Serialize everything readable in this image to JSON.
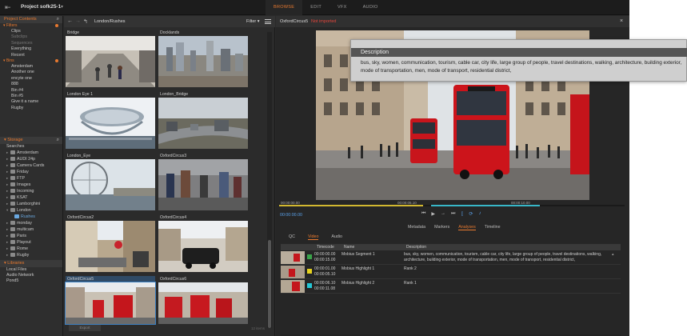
{
  "app": {
    "project_title": "Project sofk25-1",
    "modes": [
      "BROWSE",
      "EDIT",
      "VFX",
      "AUDIO"
    ],
    "active_mode": "BROWSE"
  },
  "left_panel": {
    "project_contents": "Project Contents",
    "filters_label": "Filters",
    "filters": [
      "Clips",
      "Subclips",
      "Sequences",
      "Everything",
      "Recent"
    ],
    "bins_label": "Bins",
    "bins": [
      "Amsterdam",
      "Another one",
      "encyte one",
      "888",
      "Bin #4",
      "Bin #5",
      "Give it a name",
      "Rugby"
    ],
    "storage_label": "Storage",
    "searches_label": "Searches",
    "storage_items": [
      "Amsterdam",
      "AUDI 24p",
      "Camera Cards",
      "Friday",
      "FTP",
      "Images",
      "Incoming",
      "KSAT",
      "Lamborghini",
      "London"
    ],
    "storage_child": "Rushes",
    "storage_items_after": [
      "monday",
      "multicam",
      "Paris",
      "Playout",
      "Rome",
      "Rugby"
    ],
    "libraries_label": "Libraries",
    "libraries": [
      "Local Files",
      "Audio Network",
      "Pond5"
    ]
  },
  "browser": {
    "path": "London/Rushes",
    "filter_label": "Filter ▾",
    "tiles": [
      "Bridge",
      "Docklands",
      "London Eye 1",
      "London_Bridge",
      "London_Eye",
      "OxfordCircus3",
      "OxfordCircus2",
      "OxfordCircus4",
      "OxfordCircus5",
      "OxfordCircus6"
    ],
    "count": "12 items",
    "button_label": "Export"
  },
  "viewer": {
    "clip_name": "OxfordCircus5",
    "not_saved": "Not imported",
    "current_timecode": "00:00:00.00",
    "timeline_marks": [
      "00:00:00.00",
      "00:00:05.10",
      "00:00:10.00"
    ],
    "tabs": [
      "Metadata",
      "Markers",
      "Analyses",
      "Timeline"
    ],
    "active_tab": "Analyses",
    "subtabs": [
      "QC",
      "Video",
      "Audio"
    ],
    "active_subtab": "Video",
    "columns": [
      "Timecode",
      "Name",
      "Description"
    ],
    "rows": [
      {
        "tc_in": "00:00:00.00",
        "tc_out": "00:00:15.00",
        "name": "Mobius Segment 1",
        "color": "#3aa34a",
        "desc": "bus, sky, women, communication, tourism, cable car, city life, large group of people, travel destinations, walking, architecture, building exterior, mode of transportation, men, mode of transport, residential district,"
      },
      {
        "tc_in": "00:00:01.00",
        "tc_out": "00:00:05.10",
        "name": "Mobius Highlight 1",
        "color": "#e6d21e",
        "desc": "Rank 2"
      },
      {
        "tc_in": "00:00:06.10",
        "tc_out": "00:00:11.08",
        "name": "Mobius Highlight 2",
        "color": "#25c7d6",
        "desc": "Rank 1"
      }
    ]
  },
  "popup": {
    "title": "Description",
    "text": "bus, sky, women, communication, tourism, cable car, city life, large group of people, travel destinations, walking, architecture, building exterior, mode of transportation, men, mode of transport, residential district,"
  },
  "colors": {
    "accent": "#e8792f",
    "highlight_blue": "#5aa0e8",
    "warning_red": "#e2463c"
  }
}
